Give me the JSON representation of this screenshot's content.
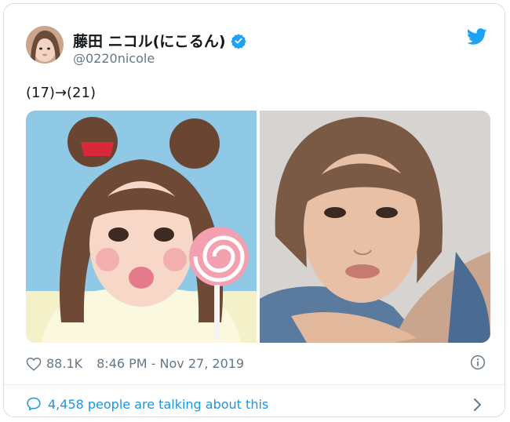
{
  "tweet": {
    "display_name": "藤田 ニコル(にこるん)",
    "handle": "@0220nicole",
    "text": "(17)→(21)",
    "like_count": "88.1K",
    "timestamp": "8:46 PM - Nov 27, 2019",
    "footer_text": "4,458 people are talking about this"
  },
  "icons": {
    "verified": "verified-badge-icon",
    "brand": "twitter-bird-icon",
    "like": "heart-icon",
    "info": "info-icon",
    "comment": "speech-bubble-icon",
    "chevron": "chevron-right-icon"
  },
  "colors": {
    "brand_blue": "#1da1f2",
    "link_blue": "#1b95e0",
    "secondary_text": "#657786",
    "primary_text": "#14171a",
    "border": "#d9dee2"
  }
}
